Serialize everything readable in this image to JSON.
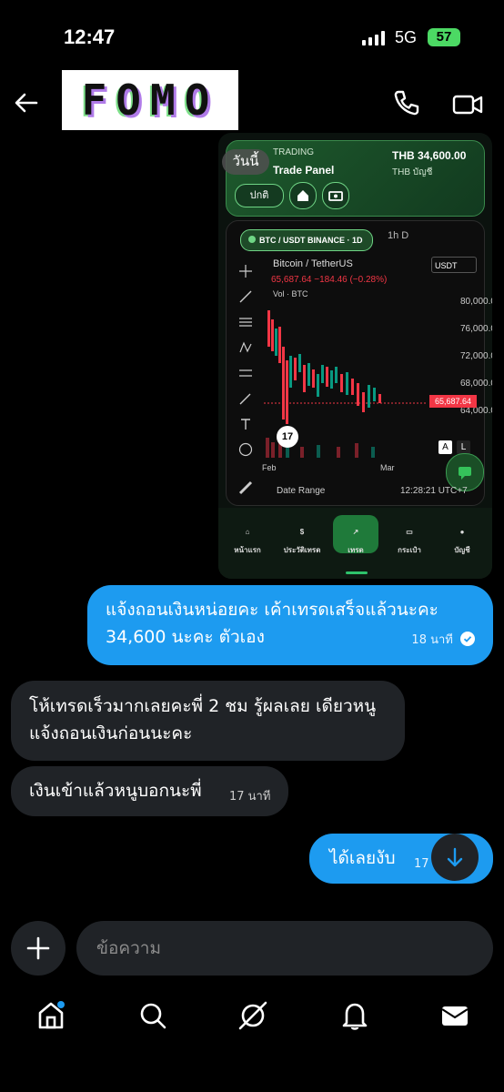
{
  "status_bar": {
    "time": "12:47",
    "network": "5G",
    "battery": "57"
  },
  "header": {
    "contact_name": "FOMO"
  },
  "shared_image": {
    "today_badge": "วันนี้",
    "trading_label": "TRADING",
    "panel_label": "Trade Panel",
    "balance": "THB 34,600.00",
    "account_label": "THB บัญชี",
    "status_pill": "ปกติ",
    "symbol_pill": "BTC / USDT BINANCE · 1D",
    "timeframes": "1h  D",
    "pair_title": "Bitcoin / TetherUS",
    "quote": "65,687.64 −184.46 (−0.28%)",
    "volume_label": "Vol · BTC",
    "unit_select": "USDT",
    "price_ticks": [
      "80,000.00",
      "76,000.00",
      "72,000.00",
      "68,000.00",
      "64,000.00"
    ],
    "last_price": "65,687.64",
    "x_ticks": [
      "Feb",
      "Mar"
    ],
    "a_btn": "A",
    "l_btn": "L",
    "tv_logo": "17",
    "date_range": "Date Range",
    "clock": "12:28:21 UTC+7",
    "nav": [
      "หน้าแรก",
      "ประวัติเทรด",
      "เทรด",
      "กระเป๋า",
      "บัญชี"
    ]
  },
  "messages": [
    {
      "text": "แจ้งถอนเงินหน่อยคะ เค้าเทรดเสร็จแล้วนะคะ 34,600 นะคะ ตัวเอง",
      "time": "18 นาที"
    },
    {
      "text": "โห้เทรดเร็วมากเลยคะพี่ 2 ชม รู้ผลเลย เดียวหนูแจ้งถอนเงินก่อนนะคะ"
    },
    {
      "text": "เงินเข้าแล้วหนูบอกนะพี่",
      "time": "17 นาที"
    },
    {
      "text": "ได้เลยงับ",
      "time": "17 นาที"
    }
  ],
  "composer": {
    "placeholder": "ข้อความ"
  },
  "colors": {
    "sent_bubble": "#1d9bf0",
    "received_bubble": "#202327",
    "accent_green": "#2ec26b"
  }
}
